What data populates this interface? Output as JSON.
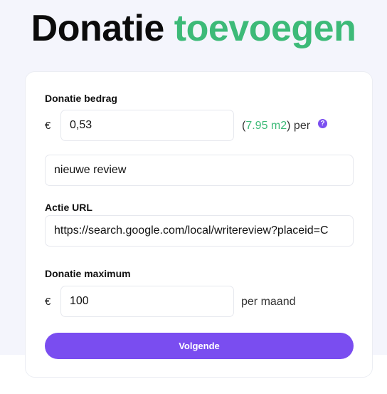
{
  "page": {
    "title_part1": "Donatie",
    "title_part2": "toevoegen"
  },
  "form": {
    "amount_label": "Donatie bedrag",
    "currency_symbol": "€",
    "amount_value": "0,53",
    "area_open": "(",
    "area_value": "7.95 m2",
    "area_close": ") per",
    "help_glyph": "?",
    "description_value": "nieuwe review",
    "url_label": "Actie URL",
    "url_value": "https://search.google.com/local/writereview?placeid=C",
    "max_label": "Donatie maximum",
    "max_value": "100",
    "max_suffix": "per maand",
    "submit_label": "Volgende"
  },
  "colors": {
    "accent_green": "#3dba78",
    "accent_purple": "#7a4df0"
  },
  "icons": {
    "help": "question-circle-icon"
  }
}
